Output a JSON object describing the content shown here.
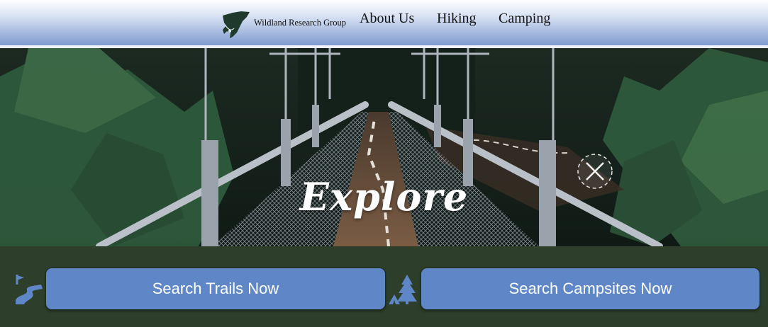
{
  "header": {
    "brand": "Wildland Research Group",
    "logo_icon": "eagle-logo-icon",
    "nav": [
      {
        "label": "About Us"
      },
      {
        "label": "Hiking"
      },
      {
        "label": "Camping"
      }
    ]
  },
  "hero": {
    "title": "Explore",
    "close_icon": "close-icon"
  },
  "actions": {
    "trails_label": "Search Trails Now",
    "campsites_label": "Search Campsites Now",
    "trail_icon": "winding-path-icon",
    "camp_icon": "tree-tent-icon"
  },
  "colors": {
    "button": "#5f86c6",
    "footer_bg": "#2d3f2b",
    "header_bottom": "#7f9bd0",
    "icon": "#5f86c6"
  }
}
